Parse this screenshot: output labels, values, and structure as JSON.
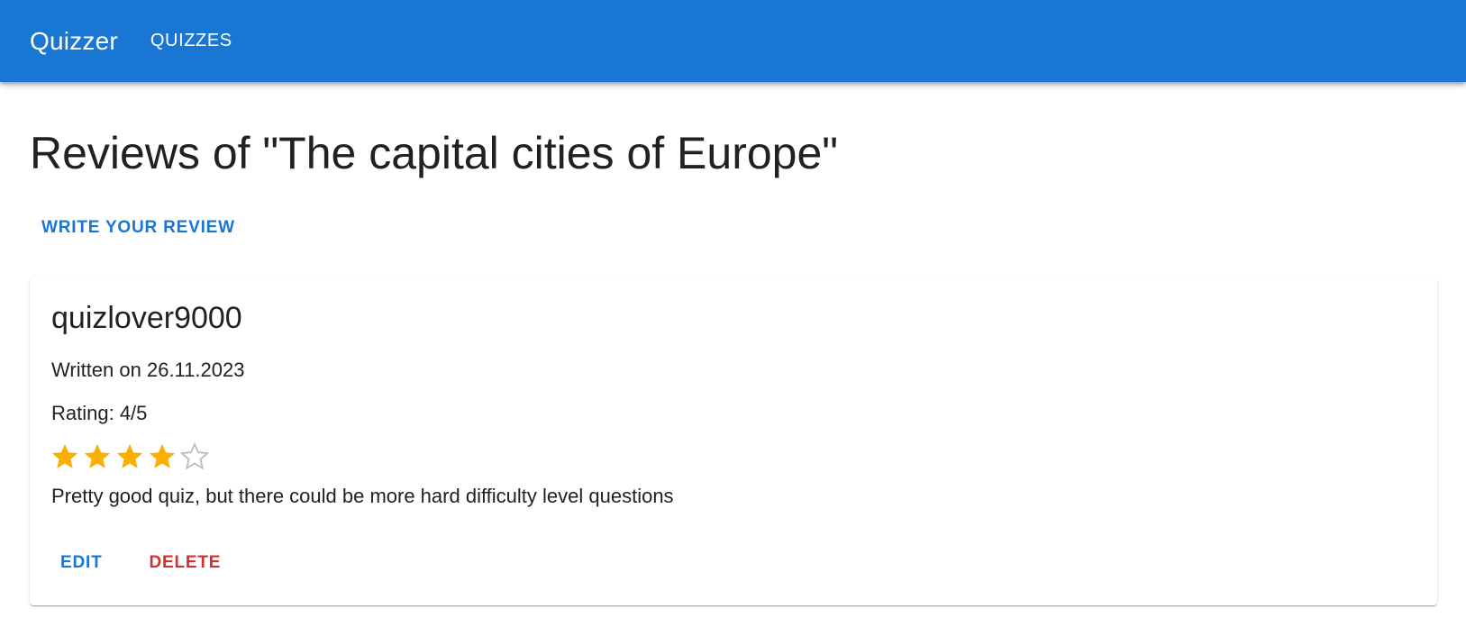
{
  "appbar": {
    "brand": "Quizzer",
    "nav": [
      "QUIZZES"
    ],
    "color": "#1976d2"
  },
  "page": {
    "title": "Reviews of \"The capital cities of Europe\"",
    "write_review_label": "WRITE YOUR REVIEW"
  },
  "reviews": [
    {
      "author": "quizlover9000",
      "written": "Written on 26.11.2023",
      "rating_text": "Rating: 4/5",
      "rating": 4,
      "rating_max": 5,
      "body": "Pretty good quiz, but there could be more hard difficulty level questions",
      "edit_label": "EDIT",
      "delete_label": "DELETE"
    }
  ],
  "colors": {
    "primary": "#1976d2",
    "danger": "#d32f2f",
    "star_filled": "#faaf00",
    "star_empty": "#bdbdbd"
  }
}
